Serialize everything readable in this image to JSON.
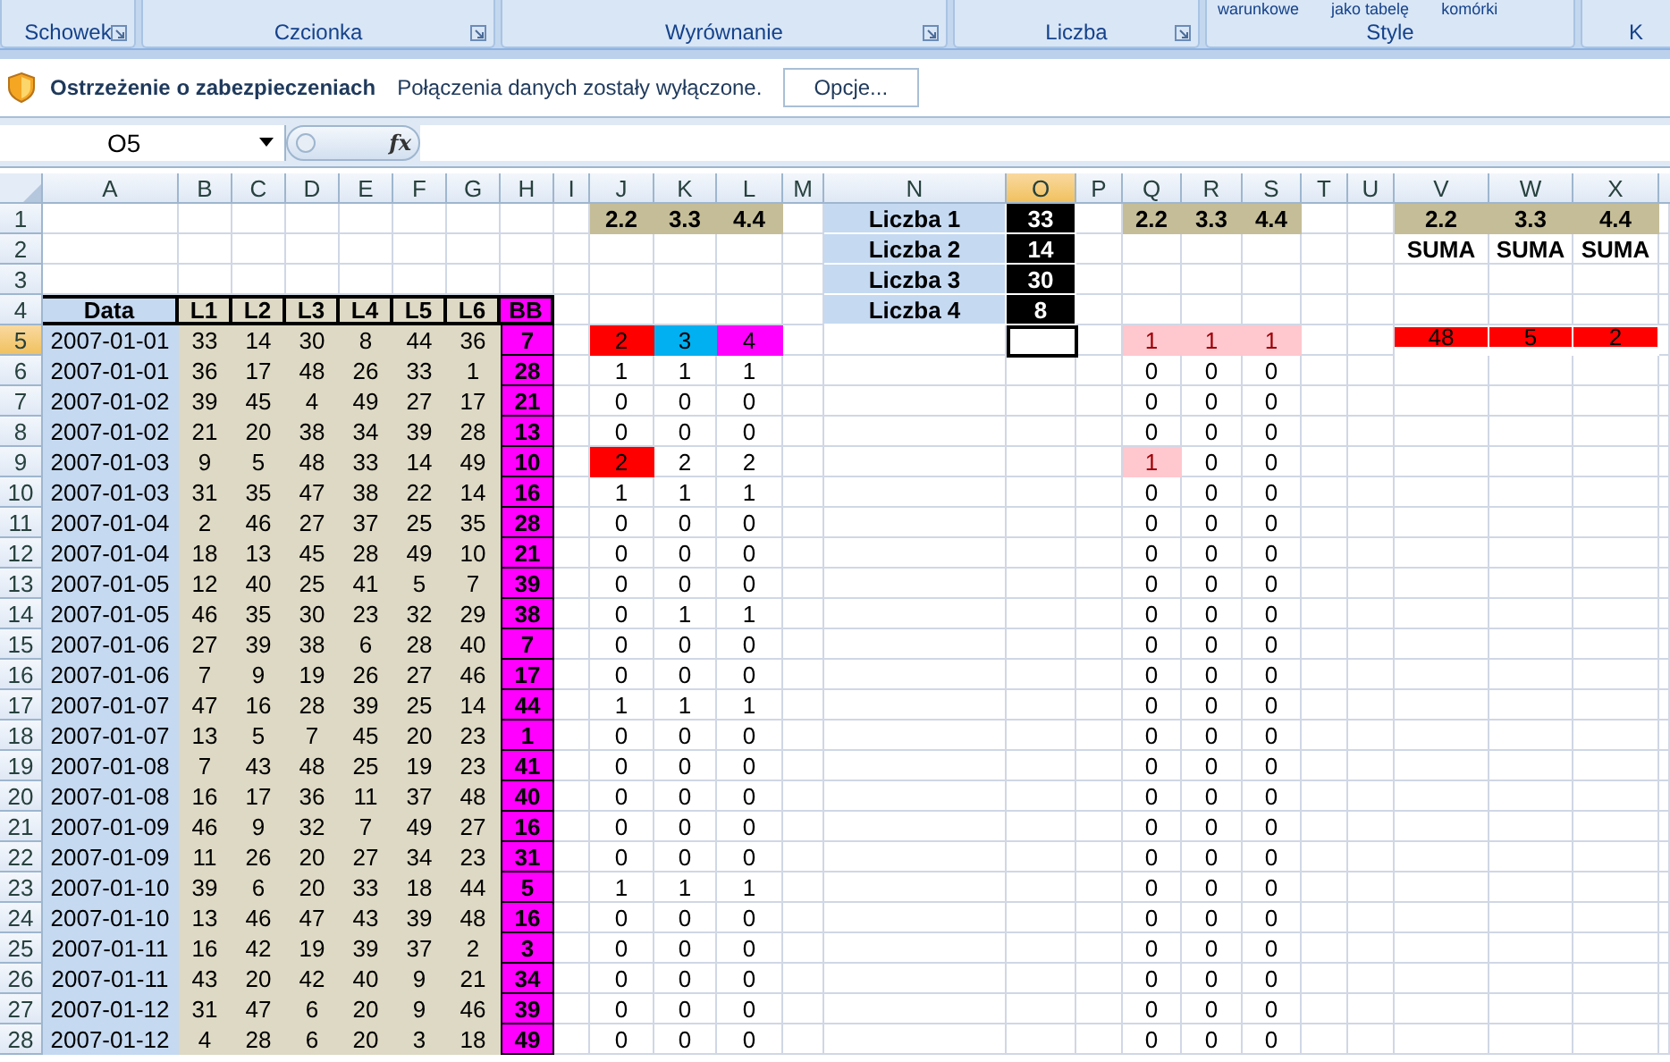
{
  "ribbon": {
    "cut_labels": [
      "warunkowe",
      "jako tabelę",
      "komórki"
    ],
    "groups": [
      {
        "label": "Schowek",
        "launcher": true
      },
      {
        "label": "Czcionka",
        "launcher": true
      },
      {
        "label": "Wyrównanie",
        "launcher": true
      },
      {
        "label": "Liczba",
        "launcher": true
      },
      {
        "label": "Style",
        "launcher": false
      },
      {
        "label": "K",
        "launcher": false
      }
    ]
  },
  "security_bar": {
    "title": "Ostrzeżenie o zabezpieczeniach",
    "message": "Połączenia danych zostały wyłączone.",
    "button": "Opcje..."
  },
  "formula_bar": {
    "name_box": "O5",
    "fx_label": "fx"
  },
  "columns": [
    {
      "letter": "A",
      "selected": false
    },
    {
      "letter": "B",
      "selected": false
    },
    {
      "letter": "C",
      "selected": false
    },
    {
      "letter": "D",
      "selected": false
    },
    {
      "letter": "E",
      "selected": false
    },
    {
      "letter": "F",
      "selected": false
    },
    {
      "letter": "G",
      "selected": false
    },
    {
      "letter": "H",
      "selected": false
    },
    {
      "letter": "I",
      "selected": false
    },
    {
      "letter": "J",
      "selected": false
    },
    {
      "letter": "K",
      "selected": false
    },
    {
      "letter": "L",
      "selected": false
    },
    {
      "letter": "M",
      "selected": false
    },
    {
      "letter": "N",
      "selected": false
    },
    {
      "letter": "O",
      "selected": true
    },
    {
      "letter": "P",
      "selected": false
    },
    {
      "letter": "Q",
      "selected": false
    },
    {
      "letter": "R",
      "selected": false
    },
    {
      "letter": "S",
      "selected": false
    },
    {
      "letter": "T",
      "selected": false
    },
    {
      "letter": "U",
      "selected": false
    },
    {
      "letter": "V",
      "selected": false
    },
    {
      "letter": "W",
      "selected": false
    },
    {
      "letter": "X",
      "selected": false
    }
  ],
  "rows": [
    {
      "number": "1",
      "selected": false,
      "cells": [
        null,
        null,
        null,
        null,
        null,
        null,
        null,
        null,
        null,
        {
          "text": "2.2",
          "kind": "key"
        },
        {
          "text": "3.3",
          "kind": "key"
        },
        {
          "text": "4.4",
          "kind": "key"
        },
        null,
        {
          "text": "Liczba 1",
          "kind": "label"
        },
        {
          "text": "33",
          "kind": "dark"
        },
        null,
        {
          "text": "2.2",
          "kind": "key"
        },
        {
          "text": "3.3",
          "kind": "key"
        },
        {
          "text": "4.4",
          "kind": "key"
        },
        null,
        null,
        {
          "text": "2.2",
          "kind": "key"
        },
        {
          "text": "3.3",
          "kind": "key"
        },
        {
          "text": "4.4",
          "kind": "key"
        }
      ]
    },
    {
      "number": "2",
      "selected": false,
      "cells": [
        null,
        null,
        null,
        null,
        null,
        null,
        null,
        null,
        null,
        null,
        null,
        null,
        null,
        {
          "text": "Liczba 2",
          "kind": "label"
        },
        {
          "text": "14",
          "kind": "dark"
        },
        null,
        null,
        null,
        null,
        null,
        null,
        {
          "text": "SUMA",
          "kind": "bold"
        },
        {
          "text": "SUMA",
          "kind": "bold"
        },
        {
          "text": "SUMA",
          "kind": "bold"
        }
      ]
    },
    {
      "number": "3",
      "selected": false,
      "cells": [
        null,
        null,
        null,
        null,
        null,
        null,
        null,
        null,
        null,
        null,
        null,
        null,
        null,
        {
          "text": "Liczba 3",
          "kind": "label"
        },
        {
          "text": "30",
          "kind": "dark"
        }
      ]
    },
    {
      "number": "4",
      "selected": false,
      "cells": [
        {
          "text": "Data",
          "kind": "head-blue"
        },
        {
          "text": "L1",
          "kind": "head-tan"
        },
        {
          "text": "L2",
          "kind": "head-tan"
        },
        {
          "text": "L3",
          "kind": "head-tan"
        },
        {
          "text": "L4",
          "kind": "head-tan"
        },
        {
          "text": "L5",
          "kind": "head-tan"
        },
        {
          "text": "L6",
          "kind": "head-tan"
        },
        {
          "text": "BB",
          "kind": "head-bb"
        },
        null,
        null,
        null,
        null,
        null,
        {
          "text": "Liczba 4",
          "kind": "label"
        },
        {
          "text": "8",
          "kind": "dark"
        }
      ]
    },
    {
      "number": "5",
      "selected": true,
      "cells": [
        "2007-01-01",
        "33",
        "14",
        "30",
        "8",
        "44",
        "36",
        "7",
        null,
        {
          "text": "2",
          "kind": "red"
        },
        {
          "text": "3",
          "kind": "cyan"
        },
        {
          "text": "4",
          "kind": "magenta"
        },
        null,
        null,
        null,
        null,
        {
          "text": "1",
          "kind": "pink"
        },
        {
          "text": "1",
          "kind": "pink"
        },
        {
          "text": "1",
          "kind": "pink"
        },
        null,
        null,
        {
          "text": "48",
          "kind": "sum"
        },
        {
          "text": "5",
          "kind": "sum"
        },
        {
          "text": "2",
          "kind": "sum"
        }
      ]
    },
    {
      "number": "6",
      "selected": false,
      "cells": [
        "2007-01-01",
        "36",
        "17",
        "48",
        "26",
        "33",
        "1",
        "28",
        null,
        "1",
        "1",
        "1",
        null,
        null,
        null,
        null,
        "0",
        "0",
        "0"
      ]
    },
    {
      "number": "7",
      "selected": false,
      "cells": [
        "2007-01-02",
        "39",
        "45",
        "4",
        "49",
        "27",
        "17",
        "21",
        null,
        "0",
        "0",
        "0",
        null,
        null,
        null,
        null,
        "0",
        "0",
        "0"
      ]
    },
    {
      "number": "8",
      "selected": false,
      "cells": [
        "2007-01-02",
        "21",
        "20",
        "38",
        "34",
        "39",
        "28",
        "13",
        null,
        "0",
        "0",
        "0",
        null,
        null,
        null,
        null,
        "0",
        "0",
        "0"
      ]
    },
    {
      "number": "9",
      "selected": false,
      "cells": [
        "2007-01-03",
        "9",
        "5",
        "48",
        "33",
        "14",
        "49",
        "10",
        null,
        {
          "text": "2",
          "kind": "red"
        },
        "2",
        "2",
        null,
        null,
        null,
        null,
        {
          "text": "1",
          "kind": "pink"
        },
        "0",
        "0"
      ]
    },
    {
      "number": "10",
      "selected": false,
      "cells": [
        "2007-01-03",
        "31",
        "35",
        "47",
        "38",
        "22",
        "14",
        "16",
        null,
        "1",
        "1",
        "1",
        null,
        null,
        null,
        null,
        "0",
        "0",
        "0"
      ]
    },
    {
      "number": "11",
      "selected": false,
      "cells": [
        "2007-01-04",
        "2",
        "46",
        "27",
        "37",
        "25",
        "35",
        "28",
        null,
        "0",
        "0",
        "0",
        null,
        null,
        null,
        null,
        "0",
        "0",
        "0"
      ]
    },
    {
      "number": "12",
      "selected": false,
      "cells": [
        "2007-01-04",
        "18",
        "13",
        "45",
        "28",
        "49",
        "10",
        "21",
        null,
        "0",
        "0",
        "0",
        null,
        null,
        null,
        null,
        "0",
        "0",
        "0"
      ]
    },
    {
      "number": "13",
      "selected": false,
      "cells": [
        "2007-01-05",
        "12",
        "40",
        "25",
        "41",
        "5",
        "7",
        "39",
        null,
        "0",
        "0",
        "0",
        null,
        null,
        null,
        null,
        "0",
        "0",
        "0"
      ]
    },
    {
      "number": "14",
      "selected": false,
      "cells": [
        "2007-01-05",
        "46",
        "35",
        "30",
        "23",
        "32",
        "29",
        "38",
        null,
        "0",
        "1",
        "1",
        null,
        null,
        null,
        null,
        "0",
        "0",
        "0"
      ]
    },
    {
      "number": "15",
      "selected": false,
      "cells": [
        "2007-01-06",
        "27",
        "39",
        "38",
        "6",
        "28",
        "40",
        "7",
        null,
        "0",
        "0",
        "0",
        null,
        null,
        null,
        null,
        "0",
        "0",
        "0"
      ]
    },
    {
      "number": "16",
      "selected": false,
      "cells": [
        "2007-01-06",
        "7",
        "9",
        "19",
        "26",
        "27",
        "46",
        "17",
        null,
        "0",
        "0",
        "0",
        null,
        null,
        null,
        null,
        "0",
        "0",
        "0"
      ]
    },
    {
      "number": "17",
      "selected": false,
      "cells": [
        "2007-01-07",
        "47",
        "16",
        "28",
        "39",
        "25",
        "14",
        "44",
        null,
        "1",
        "1",
        "1",
        null,
        null,
        null,
        null,
        "0",
        "0",
        "0"
      ]
    },
    {
      "number": "18",
      "selected": false,
      "cells": [
        "2007-01-07",
        "13",
        "5",
        "7",
        "45",
        "20",
        "23",
        "1",
        null,
        "0",
        "0",
        "0",
        null,
        null,
        null,
        null,
        "0",
        "0",
        "0"
      ]
    },
    {
      "number": "19",
      "selected": false,
      "cells": [
        "2007-01-08",
        "7",
        "43",
        "48",
        "25",
        "19",
        "23",
        "41",
        null,
        "0",
        "0",
        "0",
        null,
        null,
        null,
        null,
        "0",
        "0",
        "0"
      ]
    },
    {
      "number": "20",
      "selected": false,
      "cells": [
        "2007-01-08",
        "16",
        "17",
        "36",
        "11",
        "37",
        "48",
        "40",
        null,
        "0",
        "0",
        "0",
        null,
        null,
        null,
        null,
        "0",
        "0",
        "0"
      ]
    },
    {
      "number": "21",
      "selected": false,
      "cells": [
        "2007-01-09",
        "46",
        "9",
        "32",
        "7",
        "49",
        "27",
        "16",
        null,
        "0",
        "0",
        "0",
        null,
        null,
        null,
        null,
        "0",
        "0",
        "0"
      ]
    },
    {
      "number": "22",
      "selected": false,
      "cells": [
        "2007-01-09",
        "11",
        "26",
        "20",
        "27",
        "34",
        "23",
        "31",
        null,
        "0",
        "0",
        "0",
        null,
        null,
        null,
        null,
        "0",
        "0",
        "0"
      ]
    },
    {
      "number": "23",
      "selected": false,
      "cells": [
        "2007-01-10",
        "39",
        "6",
        "20",
        "33",
        "18",
        "44",
        "5",
        null,
        "1",
        "1",
        "1",
        null,
        null,
        null,
        null,
        "0",
        "0",
        "0"
      ]
    },
    {
      "number": "24",
      "selected": false,
      "cells": [
        "2007-01-10",
        "13",
        "46",
        "47",
        "43",
        "39",
        "48",
        "16",
        null,
        "0",
        "0",
        "0",
        null,
        null,
        null,
        null,
        "0",
        "0",
        "0"
      ]
    },
    {
      "number": "25",
      "selected": false,
      "cells": [
        "2007-01-11",
        "16",
        "42",
        "19",
        "39",
        "37",
        "2",
        "3",
        null,
        "0",
        "0",
        "0",
        null,
        null,
        null,
        null,
        "0",
        "0",
        "0"
      ]
    },
    {
      "number": "26",
      "selected": false,
      "cells": [
        "2007-01-11",
        "43",
        "20",
        "42",
        "40",
        "9",
        "21",
        "34",
        null,
        "0",
        "0",
        "0",
        null,
        null,
        null,
        null,
        "0",
        "0",
        "0"
      ]
    },
    {
      "number": "27",
      "selected": false,
      "cells": [
        "2007-01-12",
        "31",
        "47",
        "6",
        "20",
        "9",
        "46",
        "39",
        null,
        "0",
        "0",
        "0",
        null,
        null,
        null,
        null,
        "0",
        "0",
        "0"
      ]
    },
    {
      "number": "28",
      "selected": false,
      "cells": [
        "2007-01-12",
        "4",
        "28",
        "6",
        "20",
        "3",
        "18",
        "49",
        null,
        "0",
        "0",
        "0",
        null,
        null,
        null,
        null,
        "0",
        "0",
        "0"
      ]
    }
  ]
}
